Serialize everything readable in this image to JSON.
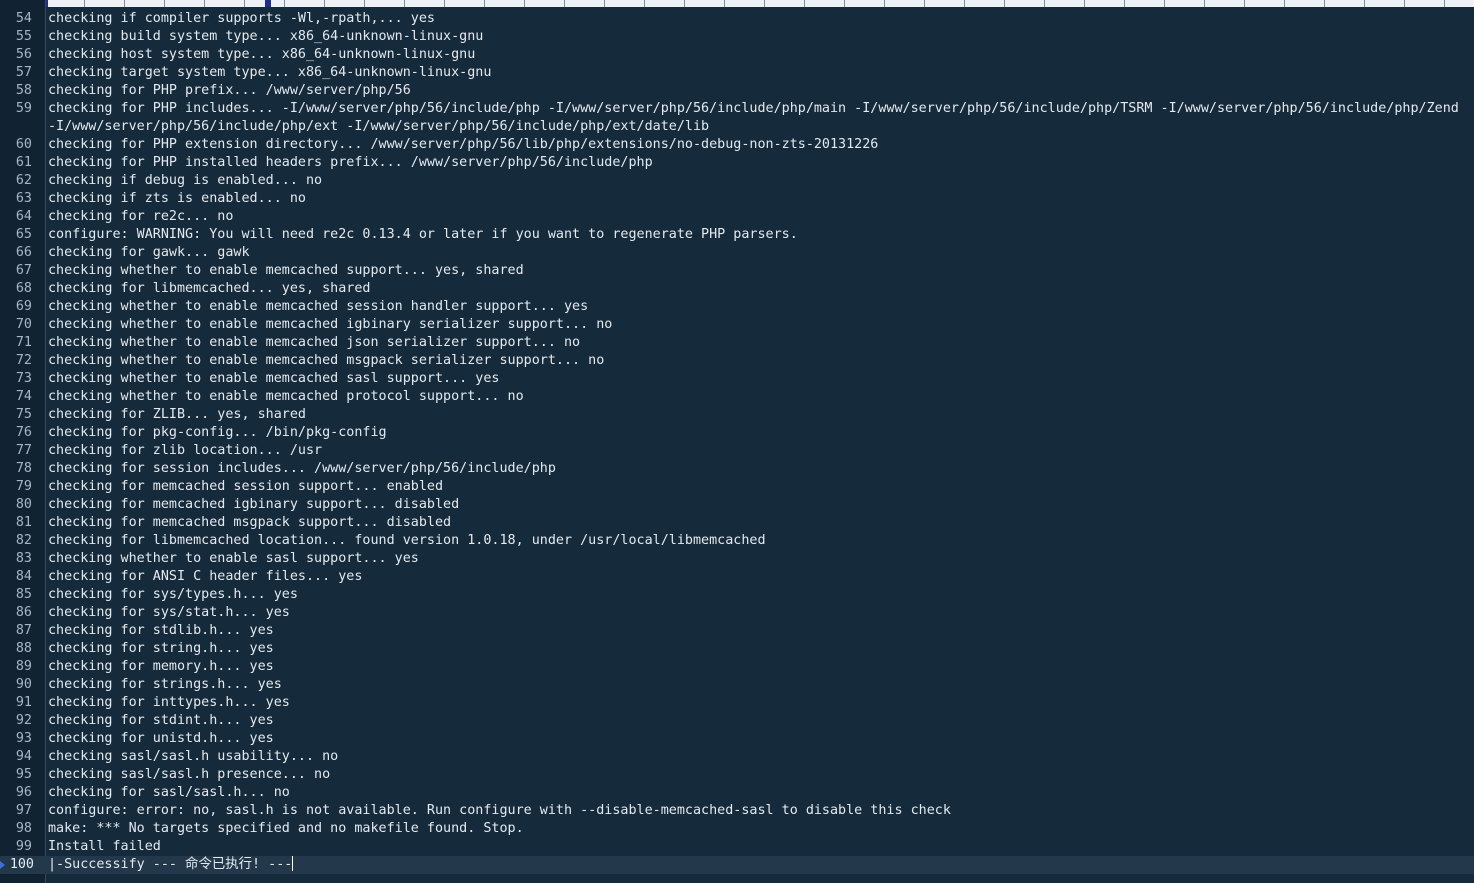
{
  "editor": {
    "lines": [
      {
        "n": "54",
        "text": "checking if compiler supports -Wl,-rpath,... yes"
      },
      {
        "n": "55",
        "text": "checking build system type... x86_64-unknown-linux-gnu"
      },
      {
        "n": "56",
        "text": "checking host system type... x86_64-unknown-linux-gnu"
      },
      {
        "n": "57",
        "text": "checking target system type... x86_64-unknown-linux-gnu"
      },
      {
        "n": "58",
        "text": "checking for PHP prefix... /www/server/php/56"
      },
      {
        "n": "59",
        "text": "checking for PHP includes... -I/www/server/php/56/include/php -I/www/server/php/56/include/php/main -I/www/server/php/56/include/php/TSRM -I/www/server/php/56/include/php/Zend -I/www/server/php/56/include/php/ext -I/www/server/php/56/include/php/ext/date/lib"
      },
      {
        "n": "60",
        "text": "checking for PHP extension directory... /www/server/php/56/lib/php/extensions/no-debug-non-zts-20131226"
      },
      {
        "n": "61",
        "text": "checking for PHP installed headers prefix... /www/server/php/56/include/php"
      },
      {
        "n": "62",
        "text": "checking if debug is enabled... no"
      },
      {
        "n": "63",
        "text": "checking if zts is enabled... no"
      },
      {
        "n": "64",
        "text": "checking for re2c... no"
      },
      {
        "n": "65",
        "text": "configure: WARNING: You will need re2c 0.13.4 or later if you want to regenerate PHP parsers."
      },
      {
        "n": "66",
        "text": "checking for gawk... gawk"
      },
      {
        "n": "67",
        "text": "checking whether to enable memcached support... yes, shared"
      },
      {
        "n": "68",
        "text": "checking for libmemcached... yes, shared"
      },
      {
        "n": "69",
        "text": "checking whether to enable memcached session handler support... yes"
      },
      {
        "n": "70",
        "text": "checking whether to enable memcached igbinary serializer support... no"
      },
      {
        "n": "71",
        "text": "checking whether to enable memcached json serializer support... no"
      },
      {
        "n": "72",
        "text": "checking whether to enable memcached msgpack serializer support... no"
      },
      {
        "n": "73",
        "text": "checking whether to enable memcached sasl support... yes"
      },
      {
        "n": "74",
        "text": "checking whether to enable memcached protocol support... no"
      },
      {
        "n": "75",
        "text": "checking for ZLIB... yes, shared"
      },
      {
        "n": "76",
        "text": "checking for pkg-config... /bin/pkg-config"
      },
      {
        "n": "77",
        "text": "checking for zlib location... /usr"
      },
      {
        "n": "78",
        "text": "checking for session includes... /www/server/php/56/include/php"
      },
      {
        "n": "79",
        "text": "checking for memcached session support... enabled"
      },
      {
        "n": "80",
        "text": "checking for memcached igbinary support... disabled"
      },
      {
        "n": "81",
        "text": "checking for memcached msgpack support... disabled"
      },
      {
        "n": "82",
        "text": "checking for libmemcached location... found version 1.0.18, under /usr/local/libmemcached"
      },
      {
        "n": "83",
        "text": "checking whether to enable sasl support... yes"
      },
      {
        "n": "84",
        "text": "checking for ANSI C header files... yes"
      },
      {
        "n": "85",
        "text": "checking for sys/types.h... yes"
      },
      {
        "n": "86",
        "text": "checking for sys/stat.h... yes"
      },
      {
        "n": "87",
        "text": "checking for stdlib.h... yes"
      },
      {
        "n": "88",
        "text": "checking for string.h... yes"
      },
      {
        "n": "89",
        "text": "checking for memory.h... yes"
      },
      {
        "n": "90",
        "text": "checking for strings.h... yes"
      },
      {
        "n": "91",
        "text": "checking for inttypes.h... yes"
      },
      {
        "n": "92",
        "text": "checking for stdint.h... yes"
      },
      {
        "n": "93",
        "text": "checking for unistd.h... yes"
      },
      {
        "n": "94",
        "text": "checking sasl/sasl.h usability... no"
      },
      {
        "n": "95",
        "text": "checking sasl/sasl.h presence... no"
      },
      {
        "n": "96",
        "text": "checking for sasl/sasl.h... no"
      },
      {
        "n": "97",
        "text": "configure: error: no, sasl.h is not available. Run configure with --disable-memcached-sasl to disable this check"
      },
      {
        "n": "98",
        "text": "make: *** No targets specified and no makefile found. Stop."
      },
      {
        "n": "99",
        "text": "Install failed"
      },
      {
        "n": "100",
        "text": "|-Successify --- 命令已执行! ---"
      }
    ]
  },
  "colors": {
    "background": "#152a3a",
    "text": "#e4e9ef",
    "line_number": "#a7b6c6",
    "current_line": "#24384b",
    "cursor_marker": "#3c6fd6"
  }
}
